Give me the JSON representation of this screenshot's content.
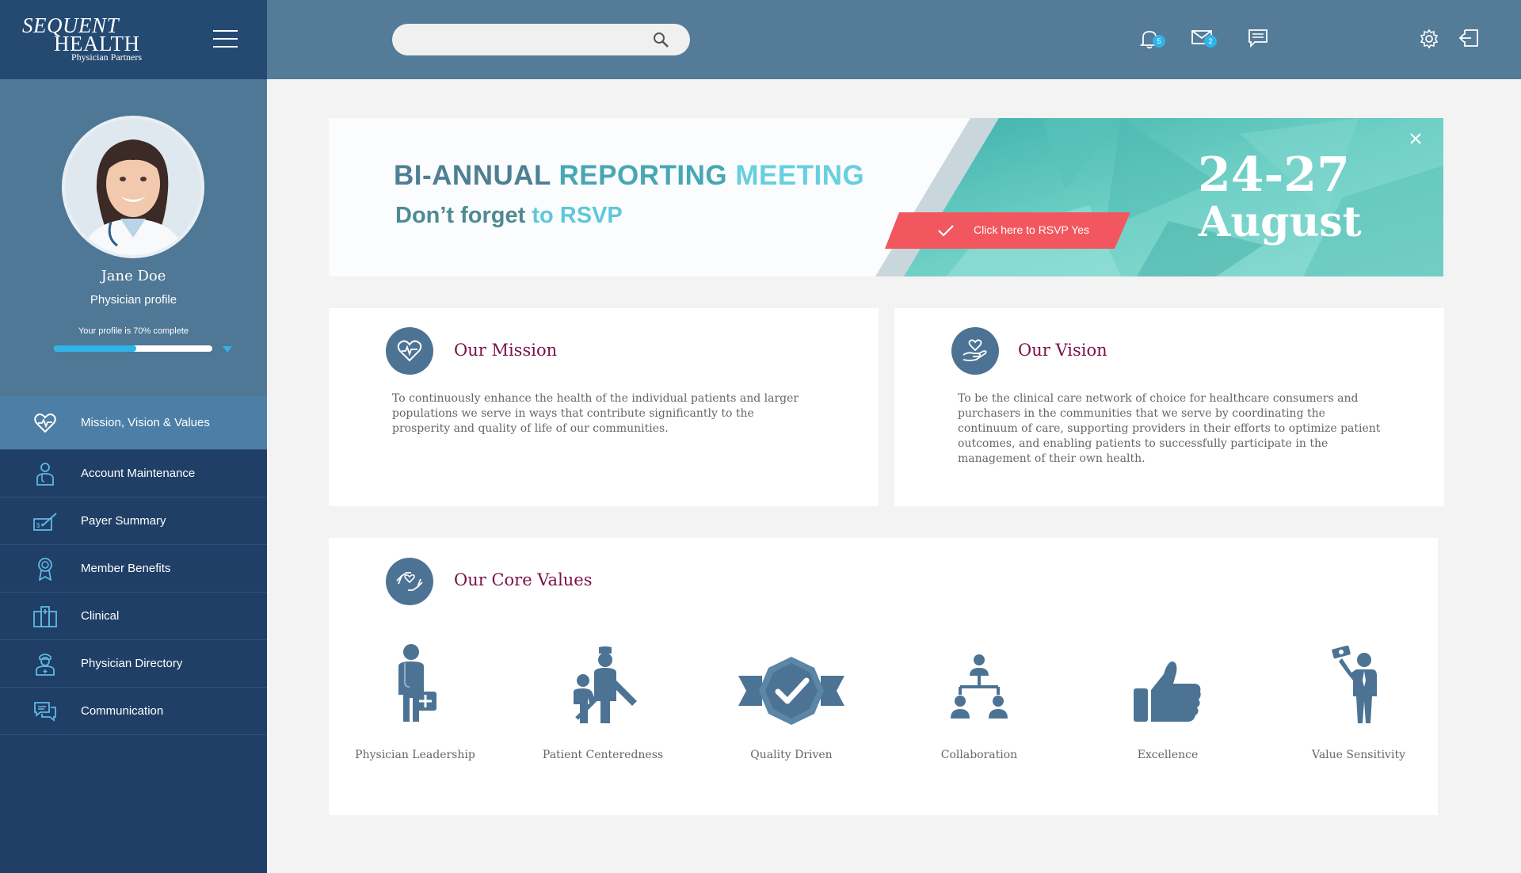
{
  "brand": {
    "line1": "SEQUENT",
    "line2": "HEALTH",
    "line3": "Physician Partners"
  },
  "search": {
    "placeholder": ""
  },
  "topbar": {
    "notifications_count": "5",
    "mail_count": "2"
  },
  "profile": {
    "name": "Jane Doe",
    "role": "Physician profile",
    "completion_text": "Your profile is 70% complete",
    "completion_fraction": 0.52
  },
  "nav": {
    "items": [
      {
        "label": "Mission, Vision & Values",
        "icon": "heart-pulse-icon"
      },
      {
        "label": "Account Maintenance",
        "icon": "doctor-icon"
      },
      {
        "label": "Payer Summary",
        "icon": "payment-icon"
      },
      {
        "label": "Member Benefits",
        "icon": "award-icon"
      },
      {
        "label": "Clinical",
        "icon": "hospital-icon"
      },
      {
        "label": "Physician Directory",
        "icon": "nurse-icon"
      },
      {
        "label": "Communication",
        "icon": "chat-icon"
      }
    ]
  },
  "banner": {
    "title_part1": "BI-ANNUAL ",
    "title_part2": "REPORTING ",
    "title_part3": "MEETING",
    "subtitle_part1": "Don’t forget ",
    "subtitle_part2": "to RSVP",
    "rsvp_label": "Click here to RSVP Yes",
    "date_line1": "24-27",
    "date_line2": "August"
  },
  "mission": {
    "title": "Our Mission",
    "text": "To continuously enhance the health of the individual patients and larger populations we serve in ways that contribute significantly to the prosperity and quality of life of our communities."
  },
  "vision": {
    "title": "Our Vision",
    "text": "To be the clinical care network of choice for healthcare consumers and purchasers in the communities that we serve by coordinating the continuum of care, supporting providers in their efforts to optimize patient outcomes, and enabling patients to successfully participate in the management of their own health."
  },
  "core_values": {
    "title": "Our Core Values",
    "items": [
      {
        "label": "Physician Leadership",
        "icon": "physician-icon"
      },
      {
        "label": "Patient Centeredness",
        "icon": "patient-care-icon"
      },
      {
        "label": "Quality Driven",
        "icon": "quality-badge-icon"
      },
      {
        "label": "Collaboration",
        "icon": "org-chart-icon"
      },
      {
        "label": "Excellence",
        "icon": "thumbs-up-icon"
      },
      {
        "label": "Value Sensitivity",
        "icon": "businessman-money-icon"
      }
    ]
  },
  "colors": {
    "sidebar": "#1f3f66",
    "topbar": "#547b98",
    "accent": "#2fb4e9",
    "title": "#7b1145",
    "rsvp": "#f2575f",
    "teal": "#5fc4bd"
  }
}
